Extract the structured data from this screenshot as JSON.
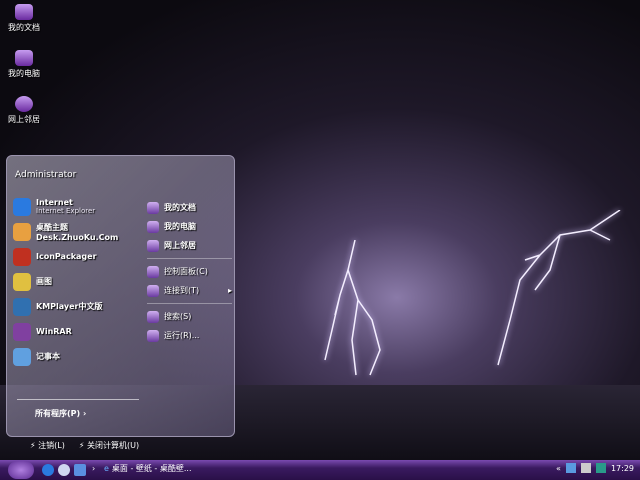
{
  "desktop_icons": [
    {
      "label": "我的文档"
    },
    {
      "label": "我的电脑"
    },
    {
      "label": "网上邻居"
    }
  ],
  "start_menu": {
    "user": "Administrator",
    "pinned": [
      {
        "label": "Internet",
        "sub": "Internet Explorer",
        "icon": "ie-icon",
        "color": "#2a7ae0"
      },
      {
        "label": "桌酷主题Desk.ZhuoKu.Com",
        "icon": "zhuoku-icon",
        "color": "#e8a040"
      },
      {
        "label": "IconPackager",
        "icon": "iconpackager-icon",
        "color": "#c03020"
      },
      {
        "label": "画图",
        "icon": "paint-icon",
        "color": "#e0c040"
      },
      {
        "label": "KMPlayer中文版",
        "icon": "kmplayer-icon",
        "color": "#3070b0"
      },
      {
        "label": "WinRAR",
        "icon": "winrar-icon",
        "color": "#8040a0"
      },
      {
        "label": "记事本",
        "icon": "notepad-icon",
        "color": "#60a0e0"
      }
    ],
    "right_top": [
      {
        "label": "我的文档",
        "icon": "my-documents-icon"
      },
      {
        "label": "我的电脑",
        "icon": "my-computer-icon"
      },
      {
        "label": "网上邻居",
        "icon": "network-icon"
      }
    ],
    "right_mid": [
      {
        "label": "控制面板(C)",
        "icon": "control-panel-icon"
      },
      {
        "label": "连接到(T)",
        "icon": "connect-icon"
      }
    ],
    "right_bot": [
      {
        "label": "搜索(S)",
        "icon": "search-icon"
      },
      {
        "label": "运行(R)...",
        "icon": "run-icon"
      }
    ],
    "all_programs": "所有程序(P)",
    "logoff": "注销(L)",
    "shutdown": "关闭计算机(U)"
  },
  "taskbar": {
    "task": "桌面 - 壁纸 - 桌酷壁...",
    "clock": "17:29"
  }
}
